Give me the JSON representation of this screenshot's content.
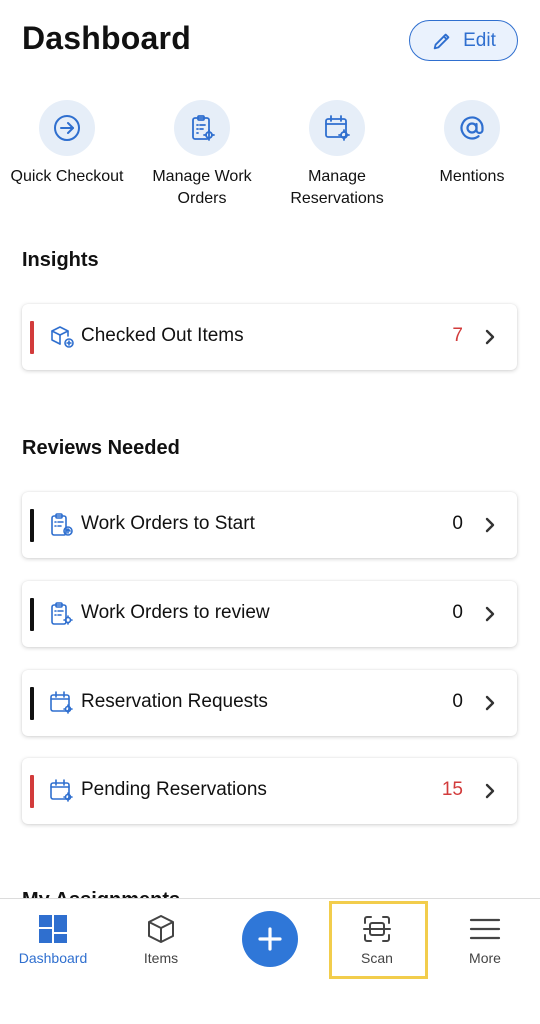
{
  "header": {
    "title": "Dashboard",
    "edit_label": "Edit"
  },
  "quick_actions": [
    {
      "label": "Quick Checkout",
      "icon": "arrow-circle-right-icon"
    },
    {
      "label": "Manage Work Orders",
      "icon": "clipboard-gear-icon"
    },
    {
      "label": "Manage Reservations",
      "icon": "calendar-gear-icon"
    },
    {
      "label": "Mentions",
      "icon": "at-sign-icon"
    }
  ],
  "insights": {
    "title": "Insights",
    "items": [
      {
        "label": "Checked Out Items",
        "count": "7",
        "bar_color": "#d23b3b",
        "count_color": "#d23b3b",
        "icon": "box-checkout-icon"
      }
    ]
  },
  "reviews": {
    "title": "Reviews Needed",
    "items": [
      {
        "label": "Work Orders to Start",
        "count": "0",
        "bar_color": "#111111",
        "count_color": "#111111",
        "icon": "clipboard-start-icon"
      },
      {
        "label": "Work Orders to review",
        "count": "0",
        "bar_color": "#111111",
        "count_color": "#111111",
        "icon": "clipboard-gear-icon"
      },
      {
        "label": "Reservation Requests",
        "count": "0",
        "bar_color": "#111111",
        "count_color": "#111111",
        "icon": "calendar-gear-icon"
      },
      {
        "label": "Pending Reservations",
        "count": "15",
        "bar_color": "#d23b3b",
        "count_color": "#d23b3b",
        "icon": "calendar-gear-icon"
      }
    ]
  },
  "partial_section_title": "My Assignments",
  "bottom_nav": {
    "items": [
      {
        "label": "Dashboard",
        "icon": "dashboard-grid-icon",
        "active": true
      },
      {
        "label": "Items",
        "icon": "cube-icon",
        "active": false
      },
      {
        "label": "",
        "icon": "plus-icon",
        "active": false
      },
      {
        "label": "Scan",
        "icon": "scan-icon",
        "active": false
      },
      {
        "label": "More",
        "icon": "menu-icon",
        "active": false
      }
    ]
  },
  "colors": {
    "accent": "#2f6fcf",
    "alert": "#d23b3b",
    "highlight": "#f2cd4c",
    "icon_bg": "#e6eef8"
  }
}
